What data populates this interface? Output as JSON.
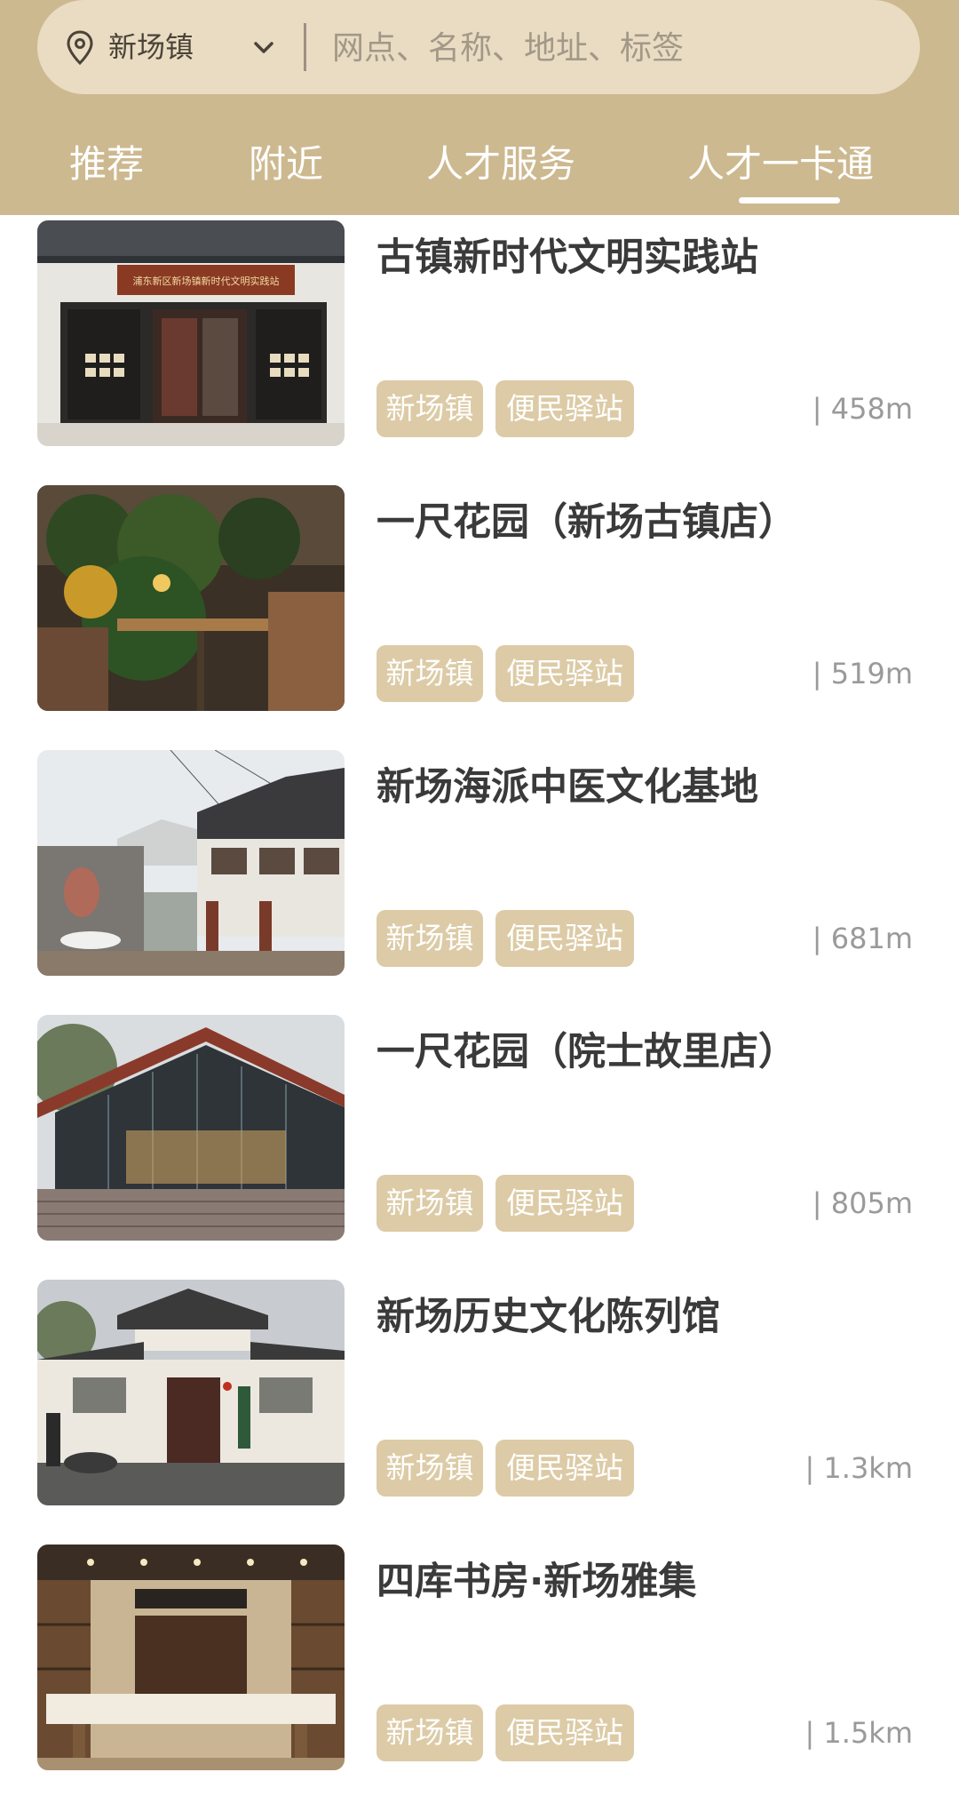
{
  "search": {
    "location": "新场镇",
    "placeholder": "网点、名称、地址、标签",
    "location_icon": "location-pin-icon",
    "dropdown_icon": "chevron-down-icon"
  },
  "tabs": [
    {
      "label": "推荐"
    },
    {
      "label": "附近"
    },
    {
      "label": "人才服务"
    },
    {
      "label": "人才一卡通",
      "active": true
    }
  ],
  "colors": {
    "header": "#cdb990",
    "search_bg": "#e9dcc2",
    "tag_bg": "#dccba6",
    "title_text": "#3a3a3a",
    "distance_text": "#9a9a9a"
  },
  "items": [
    {
      "title": "古镇新时代文明实践站",
      "tags": [
        "新场镇",
        "便民驿站"
      ],
      "distance": "| 458m",
      "sign_text": "浦东新区新场镇新时代文明实践站"
    },
    {
      "title": "一尺花园（新场古镇店）",
      "tags": [
        "新场镇",
        "便民驿站"
      ],
      "distance": "| 519m"
    },
    {
      "title": "新场海派中医文化基地",
      "tags": [
        "新场镇",
        "便民驿站"
      ],
      "distance": "| 681m"
    },
    {
      "title": "一尺花园（院士故里店）",
      "tags": [
        "新场镇",
        "便民驿站"
      ],
      "distance": "| 805m"
    },
    {
      "title": "新场历史文化陈列馆",
      "tags": [
        "新场镇",
        "便民驿站"
      ],
      "distance": "| 1.3km"
    },
    {
      "title": "四库书房·新场雅集",
      "tags": [
        "新场镇",
        "便民驿站"
      ],
      "distance": "| 1.5km"
    }
  ]
}
